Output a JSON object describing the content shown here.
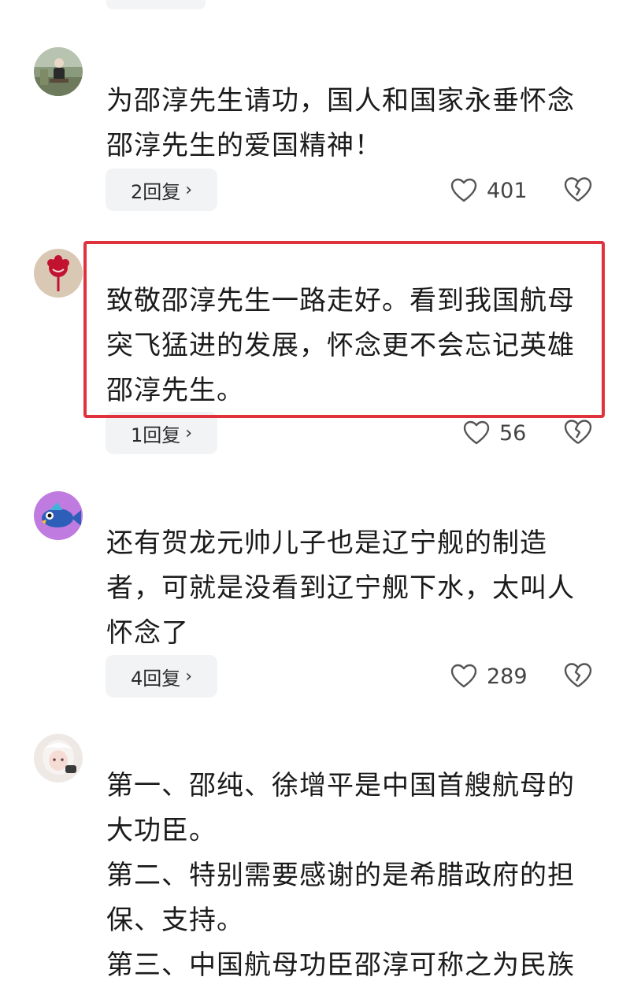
{
  "comments": [
    {
      "avatar_icon": "man-sitting-avatar-icon",
      "username": "",
      "text": "为邵淳先生请功，国人和国家永垂怀念\n邵淳先生的爱国精神！",
      "reply_label": "2回复",
      "likes": "401"
    },
    {
      "avatar_icon": "red-flower-avatar-icon",
      "username": "",
      "text": "致敬邵淳先生一路走好。看到我国航母\n突飞猛进的发展，怀念更不会忘记英雄\n邵淳先生。",
      "reply_label": "1回复",
      "likes": "56"
    },
    {
      "avatar_icon": "cartoon-fish-avatar-icon",
      "username": "",
      "text": "还有贺龙元帅儿子也是辽宁舰的制造\n者，可就是没看到辽宁舰下水，太叫人\n怀念了",
      "reply_label": "4回复",
      "likes": "289"
    },
    {
      "avatar_icon": "anime-girl-avatar-icon",
      "username": "",
      "text": "第一、邵纯、徐增平是中国首艘航母的\n大功臣。\n第二、特别需要感谢的是希腊政府的担\n保、支持。\n第三、中国航母功臣邵淳可称之为民族",
      "reply_label": "",
      "likes": ""
    }
  ],
  "colors": {
    "highlight": "#e0323c",
    "reply_bg": "#f2f3f5",
    "text": "#1b1b1b"
  },
  "icons": {
    "like": "heart-outline-icon",
    "dislike": "broken-heart-icon",
    "chevron": "chevron-right-icon"
  }
}
